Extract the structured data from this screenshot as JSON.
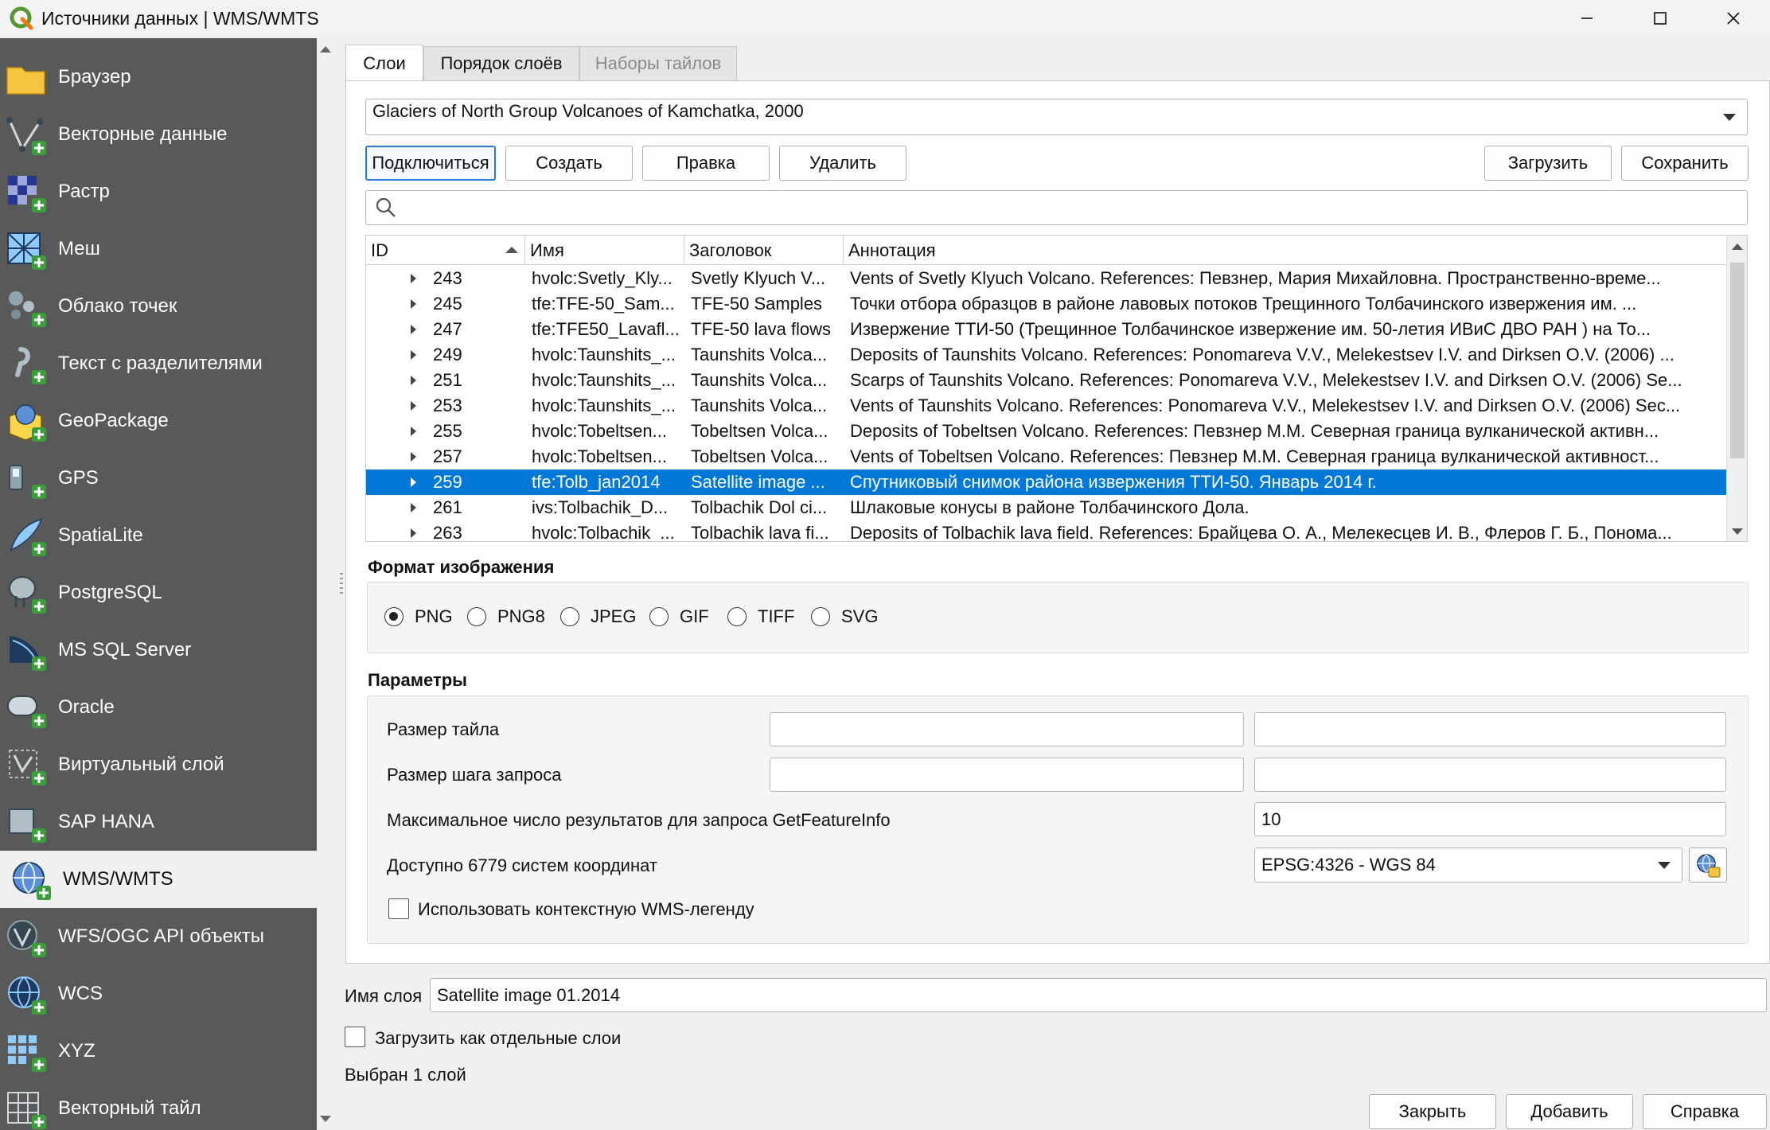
{
  "window": {
    "title": "Источники данных | WMS/WMTS"
  },
  "sidebar": {
    "items": [
      {
        "label": "Браузер",
        "icon": "folder-icon"
      },
      {
        "label": "Векторные данные",
        "icon": "vector-layer-icon"
      },
      {
        "label": "Растр",
        "icon": "raster-layer-icon"
      },
      {
        "label": "Меш",
        "icon": "mesh-layer-icon"
      },
      {
        "label": "Облако точек",
        "icon": "point-cloud-icon"
      },
      {
        "label": "Текст с разделителями",
        "icon": "delimited-text-icon"
      },
      {
        "label": "GeoPackage",
        "icon": "geopackage-icon"
      },
      {
        "label": "GPS",
        "icon": "gps-icon"
      },
      {
        "label": "SpatiaLite",
        "icon": "spatialite-icon"
      },
      {
        "label": "PostgreSQL",
        "icon": "postgresql-icon"
      },
      {
        "label": "MS SQL Server",
        "icon": "mssql-icon"
      },
      {
        "label": "Oracle",
        "icon": "oracle-icon"
      },
      {
        "label": "Виртуальный слой",
        "icon": "virtual-layer-icon"
      },
      {
        "label": "SAP HANA",
        "icon": "sap-hana-icon"
      },
      {
        "label": "WMS/WMTS",
        "icon": "wms-icon",
        "active": true
      },
      {
        "label": "WFS/OGC API объекты",
        "icon": "wfs-icon"
      },
      {
        "label": "WCS",
        "icon": "wcs-icon"
      },
      {
        "label": "XYZ",
        "icon": "xyz-icon"
      },
      {
        "label": "Векторный тайл",
        "icon": "vector-tile-icon"
      }
    ]
  },
  "tabs": [
    {
      "label": "Слои",
      "active": true
    },
    {
      "label": "Порядок слоёв"
    },
    {
      "label": "Наборы тайлов",
      "disabled": true
    }
  ],
  "connection": {
    "selected": "Glaciers of North Group Volcanoes of Kamchatka, 2000"
  },
  "buttons": {
    "connect": "Подключиться",
    "create": "Создать",
    "edit": "Правка",
    "delete": "Удалить",
    "load": "Загрузить",
    "save": "Сохранить"
  },
  "search": {
    "value": "",
    "icon": "search-icon"
  },
  "table": {
    "columns": [
      "ID",
      "Имя",
      "Заголовок",
      "Аннотация"
    ],
    "rows": [
      {
        "id": "243",
        "name": "hvolc:Svetly_Kly...",
        "title": "Svetly Klyuch V...",
        "abstract": "Vents of Svetly Klyuch Volcano. References: Певзнер, Мария Михайловна. Пространственно-време..."
      },
      {
        "id": "245",
        "name": "tfe:TFE-50_Sam...",
        "title": "TFE-50 Samples",
        "abstract": "Точки отбора образцов в районе лавовых потоков Трещинного Толбачинского извержения им. ..."
      },
      {
        "id": "247",
        "name": "tfe:TFE50_Lavafl...",
        "title": "TFE-50 lava flows",
        "abstract": "Извержение ТТИ-50 (Трещинное Толбачинское извержение им. 50-летия ИВиС ДВО РАН ) на То..."
      },
      {
        "id": "249",
        "name": "hvolc:Taunshits_...",
        "title": "Taunshits Volca...",
        "abstract": "Deposits of Taunshits Volcano. References: Ponomareva V.V., Melekestsev I.V. and Dirksen O.V. (2006) ..."
      },
      {
        "id": "251",
        "name": "hvolc:Taunshits_...",
        "title": "Taunshits Volca...",
        "abstract": "Scarps of Taunshits Volcano. References: Ponomareva V.V., Melekestsev I.V. and Dirksen O.V. (2006) Se..."
      },
      {
        "id": "253",
        "name": "hvolc:Taunshits_...",
        "title": "Taunshits Volca...",
        "abstract": "Vents of Taunshits Volcano. References: Ponomareva V.V., Melekestsev I.V. and Dirksen O.V. (2006) Sec..."
      },
      {
        "id": "255",
        "name": "hvolc:Tobeltsen...",
        "title": "Tobeltsen Volca...",
        "abstract": "Deposits of Tobeltsen Volcano. References: Певзнер М.М. Северная граница вулканической активн..."
      },
      {
        "id": "257",
        "name": "hvolc:Tobeltsen...",
        "title": "Tobeltsen Volca...",
        "abstract": "Vents of Tobeltsen Volcano. References: Певзнер М.М. Северная граница вулканической активност..."
      },
      {
        "id": "259",
        "name": "tfe:Tolb_jan2014",
        "title": "Satellite image ...",
        "abstract": "Спутниковый снимок района извержения ТТИ-50. Январь 2014 г.",
        "selected": true
      },
      {
        "id": "261",
        "name": "ivs:Tolbachik_D...",
        "title": "Tolbachik Dol ci...",
        "abstract": "Шлаковые конусы в районе Толбачинского Дола."
      },
      {
        "id": "263",
        "name": "hvolc:Tolbachik_...",
        "title": "Tolbachik lava fi...",
        "abstract": "Deposits of Tolbachik lava field. References: Брайцева О. А., Мелекесцев И. В., Флеров Г. Б., Понома..."
      }
    ]
  },
  "image_format": {
    "title": "Формат изображения",
    "options": [
      "PNG",
      "PNG8",
      "JPEG",
      "GIF",
      "TIFF",
      "SVG"
    ],
    "selected": "PNG"
  },
  "params": {
    "title": "Параметры",
    "tile_size_label": "Размер тайла",
    "tile_size_w": "",
    "tile_size_h": "",
    "step_size_label": "Размер шага запроса",
    "step_size_w": "",
    "step_size_h": "",
    "max_results_label": "Максимальное число результатов для запроса GetFeatureInfo",
    "max_results_value": "10",
    "crs_label": "Доступно 6779 систем координат",
    "crs_value": "EPSG:4326 - WGS 84",
    "crs_button_icon": "crs-select-icon",
    "contextual_legend_label": "Использовать контекстную WMS-легенду",
    "contextual_legend_checked": false
  },
  "footer": {
    "layer_name_label": "Имя слоя",
    "layer_name_value": "Satellite image 01.2014",
    "separate_layers_label": "Загрузить как отдельные слои",
    "separate_layers_checked": false,
    "status": "Выбран 1 слой",
    "close": "Закрыть",
    "add": "Добавить",
    "help": "Справка"
  }
}
